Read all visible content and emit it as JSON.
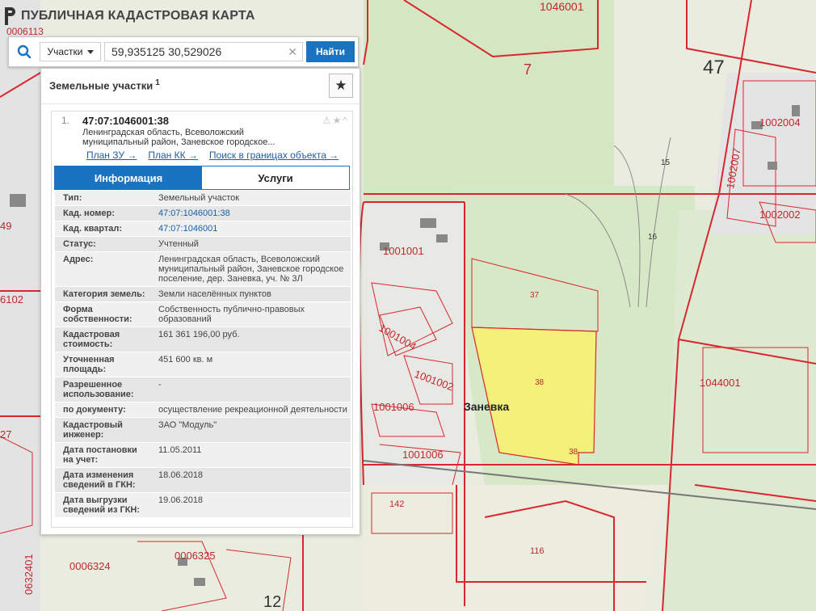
{
  "app": {
    "title": "ПУБЛИЧНАЯ КАДАСТРОВАЯ КАРТА"
  },
  "search": {
    "type_label": "Участки",
    "query": "59,935125 30,529026",
    "button_label": "Найти",
    "clear_symbol": "✕"
  },
  "panel": {
    "title": "Земельные участки",
    "count": "1",
    "fav_symbol": "★"
  },
  "result": {
    "index": "1.",
    "cadastral_id": "47:07:1046001:38",
    "address_line1": "Ленинградская область, Всеволожский",
    "address_line2": "муниципальный район, Заневское городское...",
    "actions": "⚠★^",
    "links": {
      "plan_zu": "План ЗУ →",
      "plan_kk": "План КК →",
      "search_bounds": "Поиск в границах объекта →"
    }
  },
  "tabs": [
    {
      "label": "Информация",
      "active": true
    },
    {
      "label": "Услуги",
      "active": false
    }
  ],
  "info": {
    "type": {
      "label": "Тип:",
      "value": "Земельный участок"
    },
    "kad_number": {
      "label": "Кад. номер:",
      "value": "47:07:1046001:38"
    },
    "kad_quarter": {
      "label": "Кад. квартал:",
      "value": "47:07:1046001"
    },
    "status": {
      "label": "Статус:",
      "value": "Учтенный"
    },
    "address": {
      "label": "Адрес:",
      "value": "Ленинградская область, Всеволожский муниципальный район, Заневское городское поселение, дер. Заневка, уч. № 3Л"
    },
    "land_category": {
      "label": "Категория земель:",
      "value": "Земли населённых пунктов"
    },
    "ownership": {
      "label": "Форма собственности:",
      "value": "Собственность публично-правовых образований"
    },
    "cadastral_value": {
      "label": "Кадастровая стоимость:",
      "value": "161 361 196,00 руб."
    },
    "area": {
      "label": "Уточненная площадь:",
      "value": "451 600 кв. м"
    },
    "permitted_use": {
      "label": "Разрешенное использование:",
      "value": "-"
    },
    "by_document": {
      "label": "по документу:",
      "value": "осуществление рекреационной деятельности"
    },
    "engineer": {
      "label": "Кадастровый инженер:",
      "value": "ЗАО \"Модуль\""
    },
    "registration_date": {
      "label": "Дата постановки на учет:",
      "value": "11.05.2011"
    },
    "change_date": {
      "label": "Дата изменения сведений в ГКН:",
      "value": "18.06.2018"
    },
    "export_date": {
      "label": "Дата выгрузки сведений из ГКН:",
      "value": "19.06.2018"
    }
  },
  "map": {
    "labels": {
      "block_1046001": "1046001",
      "block_0006113": "0006113",
      "zone_7": "7",
      "district_47": "47",
      "block_1002004": "1002004",
      "block_1002007": "1002007",
      "block_1002002": "1002002",
      "road_15": "15",
      "road_16": "16",
      "block_1001001": "1001001",
      "block_1001004": "1001004",
      "block_1001002": "1001002",
      "block_1001006_a": "1001006",
      "block_1001006_b": "1001006",
      "parcel_37": "37",
      "parcel_38": "38",
      "parcel_38b": "38",
      "village_zanevka": "Заневка",
      "block_1044001": "1044001",
      "parcel_142": "142",
      "parcel_116": "116",
      "block_0006324": "0006324",
      "block_0006325": "0006325",
      "block_0632401": "0632401",
      "zone_12": "12",
      "edge_6102": "6102",
      "edge_49": "49",
      "edge_27": "27"
    },
    "colors": {
      "forest": "#cfe3bf",
      "field": "#eef0e4",
      "boundary": "#d8272f",
      "highlight": "#f5f07a"
    }
  }
}
